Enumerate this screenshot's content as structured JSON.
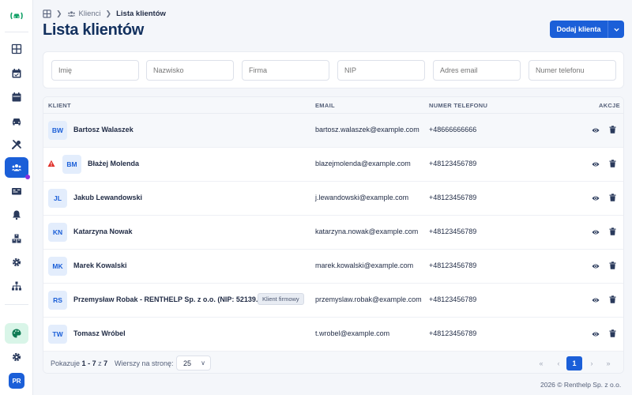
{
  "app": {
    "user_initials": "PR"
  },
  "breadcrumb": {
    "home_icon": "grid-icon",
    "clients_label": "Klienci",
    "current_label": "Lista klientów"
  },
  "page": {
    "title": "Lista klientów",
    "add_button_label": "Dodaj klienta"
  },
  "sidebar": {
    "items": [
      {
        "icon": "dashboard-icon"
      },
      {
        "icon": "calendar-check-icon"
      },
      {
        "icon": "calendar-icon"
      },
      {
        "icon": "car-icon"
      },
      {
        "icon": "tools-icon"
      },
      {
        "icon": "users-icon",
        "active": true
      },
      {
        "icon": "id-card-icon"
      },
      {
        "icon": "bell-icon"
      },
      {
        "icon": "boxes-icon"
      },
      {
        "icon": "gear-icon"
      },
      {
        "icon": "network-icon"
      }
    ]
  },
  "filters": {
    "first_name_placeholder": "Imię",
    "last_name_placeholder": "Nazwisko",
    "company_placeholder": "Firma",
    "nip_placeholder": "NIP",
    "email_placeholder": "Adres email",
    "phone_placeholder": "Numer telefonu"
  },
  "table": {
    "headers": {
      "client": "KLIENT",
      "email": "EMAIL",
      "phone": "NUMER TELEFONU",
      "actions": "AKCJE"
    },
    "rows": [
      {
        "initials": "BW",
        "name": "Bartosz Walaszek",
        "email": "bartosz.walaszek@example.com",
        "phone": "+48666666666",
        "warning": false,
        "badge": ""
      },
      {
        "initials": "BM",
        "name": "Błażej Molenda",
        "email": "blazejmolenda@example.com",
        "phone": "+48123456789",
        "warning": true,
        "badge": ""
      },
      {
        "initials": "JL",
        "name": "Jakub Lewandowski",
        "email": "j.lewandowski@example.com",
        "phone": "+48123456789",
        "warning": false,
        "badge": ""
      },
      {
        "initials": "KN",
        "name": "Katarzyna Nowak",
        "email": "katarzyna.nowak@example.com",
        "phone": "+48123456789",
        "warning": false,
        "badge": ""
      },
      {
        "initials": "MK",
        "name": "Marek Kowalski",
        "email": "marek.kowalski@example.com",
        "phone": "+48123456789",
        "warning": false,
        "badge": ""
      },
      {
        "initials": "RS",
        "name": "Przemysław Robak - RENTHELP Sp. z o.o. (NIP: 52139...",
        "email": "przemyslaw.robak@example.com",
        "phone": "+48123456789",
        "warning": false,
        "badge": "Klient firmowy"
      },
      {
        "initials": "TW",
        "name": "Tomasz Wróbel",
        "email": "t.wrobel@example.com",
        "phone": "+48123456789",
        "warning": false,
        "badge": ""
      }
    ]
  },
  "pagination": {
    "showing_label": "Pokazuje",
    "from": "1",
    "dash": "-",
    "to": "7",
    "of_label": "z",
    "total": "7",
    "rows_per_page_label": "Wierszy na stronę:",
    "rows_per_page_value": "25",
    "current_page": "1",
    "first_glyph": "«",
    "prev_glyph": "‹",
    "next_glyph": "›",
    "last_glyph": "»"
  },
  "footer": {
    "copyright": "2026 © Renthelp Sp. z o.o."
  },
  "colors": {
    "primary": "#1b5fd8",
    "title": "#12305e",
    "warning": "#e0312b",
    "accent_purple": "#8b2fdd",
    "logo_green": "#16a36a"
  }
}
